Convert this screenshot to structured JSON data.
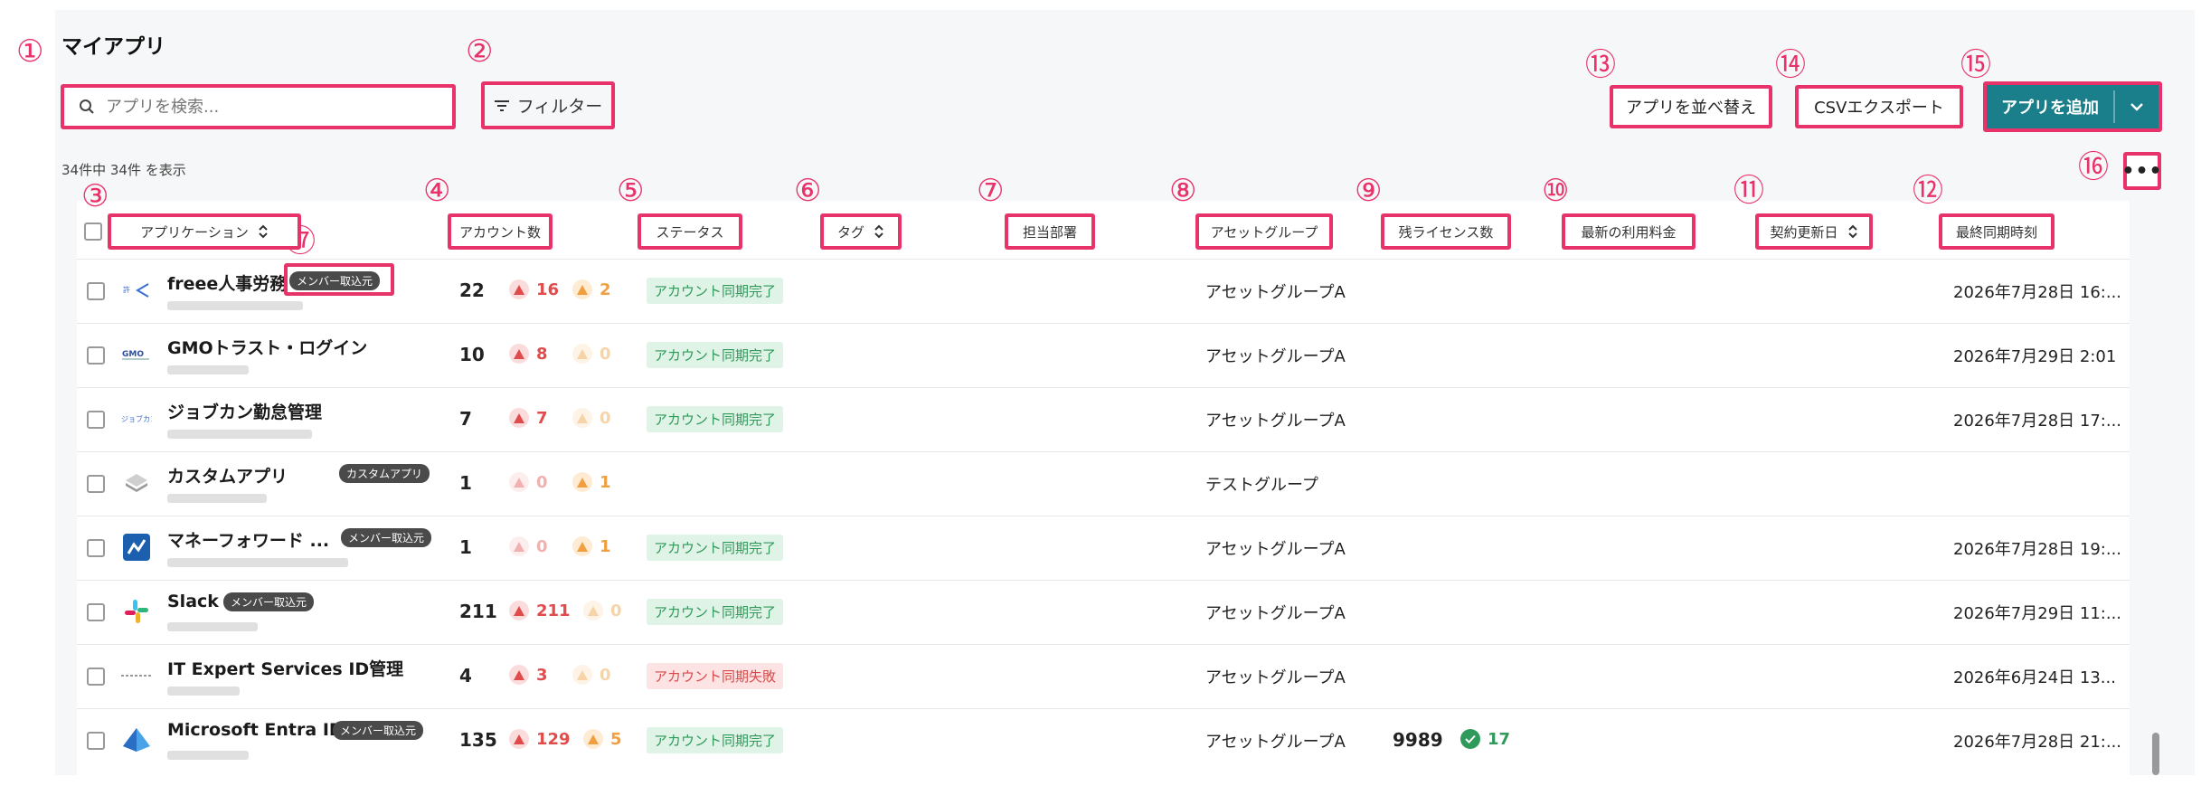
{
  "page": {
    "title": "マイアプリ",
    "count_text": "34件中 34件 を表示"
  },
  "toolbar": {
    "search_placeholder": "アプリを検索...",
    "filter_label": "フィルター",
    "sort_label": "アプリを並べ替え",
    "csv_label": "CSVエクスポート",
    "add_label": "アプリを追加",
    "more_label": "•••"
  },
  "markers": [
    "①",
    "②",
    "③",
    "④",
    "⑤",
    "⑥",
    "⑦",
    "⑧",
    "⑨",
    "⑩",
    "⑪",
    "⑫",
    "⑬",
    "⑭",
    "⑮",
    "⑯",
    "⑰"
  ],
  "columns": {
    "application": "アプリケーション",
    "account_count": "アカウント数",
    "status": "ステータス",
    "tag": "タグ",
    "department": "担当部署",
    "asset_group": "アセットグループ",
    "remaining_licenses": "残ライセンス数",
    "latest_fee": "最新の利用料金",
    "renewal_date": "契約更新日",
    "last_sync": "最終同期時刻"
  },
  "rows": [
    {
      "name": "freee人事労務",
      "badge": "メンバー取込元",
      "accounts": "22",
      "red": "16",
      "orange": "2",
      "status": "アカウント同期完了",
      "status_type": "ok",
      "group": "アセットグループA",
      "licenses": "",
      "license_ok": "",
      "sync": "2026年7月28日 16:...",
      "icon": "freee-icon"
    },
    {
      "name": "GMOトラスト・ログイン",
      "badge": "",
      "accounts": "10",
      "red": "8",
      "orange": "0",
      "status": "アカウント同期完了",
      "status_type": "ok",
      "group": "アセットグループA",
      "licenses": "",
      "license_ok": "",
      "sync": "2026年7月29日 2:01",
      "icon": "gmo-icon"
    },
    {
      "name": "ジョブカン勤怠管理",
      "badge": "",
      "accounts": "7",
      "red": "7",
      "orange": "0",
      "status": "アカウント同期完了",
      "status_type": "ok",
      "group": "アセットグループA",
      "licenses": "",
      "license_ok": "",
      "sync": "2026年7月28日 17:...",
      "icon": "jobcan-icon"
    },
    {
      "name": "カスタムアプリ",
      "badge": "カスタムアプリ",
      "accounts": "1",
      "red": "0",
      "orange": "1",
      "status": "",
      "status_type": "",
      "group": "テストグループ",
      "licenses": "",
      "license_ok": "",
      "sync": "",
      "icon": "custom-app-icon"
    },
    {
      "name": "マネーフォワード ...",
      "badge": "メンバー取込元",
      "accounts": "1",
      "red": "0",
      "orange": "1",
      "status": "アカウント同期完了",
      "status_type": "ok",
      "group": "アセットグループA",
      "licenses": "",
      "license_ok": "",
      "sync": "2026年7月28日 19:...",
      "icon": "moneyforward-icon"
    },
    {
      "name": "Slack",
      "badge": "メンバー取込元",
      "accounts": "211",
      "red": "211",
      "orange": "0",
      "status": "アカウント同期完了",
      "status_type": "ok",
      "group": "アセットグループA",
      "licenses": "",
      "license_ok": "",
      "sync": "2026年7月29日 11:...",
      "icon": "slack-icon"
    },
    {
      "name": "IT Expert Services ID管理",
      "badge": "",
      "accounts": "4",
      "red": "3",
      "orange": "0",
      "status": "アカウント同期失敗",
      "status_type": "ng",
      "group": "アセットグループA",
      "licenses": "",
      "license_ok": "",
      "sync": "2026年6月24日 13...",
      "icon": "it-expert-icon"
    },
    {
      "name": "Microsoft Entra ID",
      "badge": "メンバー取込元",
      "accounts": "135",
      "red": "129",
      "orange": "5",
      "status": "アカウント同期完了",
      "status_type": "ok",
      "group": "アセットグループA",
      "licenses": "9989",
      "license_ok": "17",
      "sync": "2026年7月28日 21:...",
      "icon": "entra-icon"
    }
  ],
  "colors": {
    "accent": "#1a7f8a",
    "highlight": "#e8336a",
    "red_warn": "#e04b4b",
    "orange_warn": "#f0a040",
    "ok_green": "#2f9a5a"
  }
}
